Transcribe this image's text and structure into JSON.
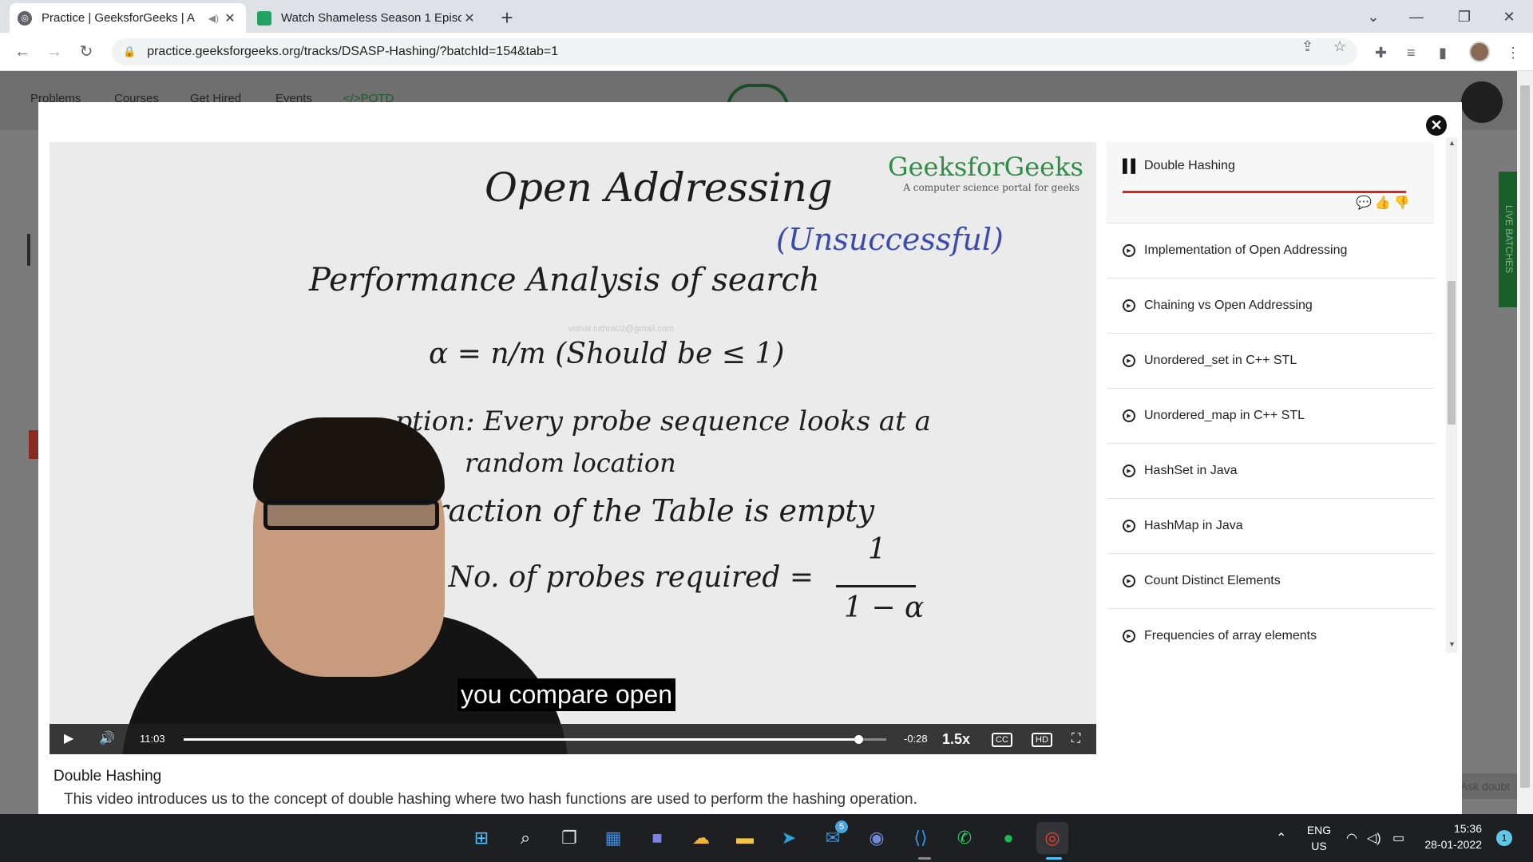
{
  "tabs": [
    {
      "title": "Practice | GeeksforGeeks | A",
      "active": true
    },
    {
      "title": "Watch Shameless Season 1 Episo",
      "active": false
    }
  ],
  "address_url": "practice.geeksforgeeks.org/tracks/DSASP-Hashing/?batchId=154&tab=1",
  "page_nav": [
    "Problems",
    "Courses",
    "Get Hired",
    "Events",
    "</>POTD"
  ],
  "live_tab": "LIVE BATCHES",
  "ask_doubt": "Ask doubt",
  "video": {
    "whiteboard": {
      "title": "Open Addressing",
      "heading": "Performance Analysis of search",
      "heading_note": "(Unsuccessful)",
      "alpha_line": "α = n/m (Should be ≤ 1)",
      "assumption_1": "...ption: Every probe sequence looks at a",
      "assumption_2": "random location",
      "fraction": "Fraction of the Table is empty",
      "probes": "...ted No. of probes required =",
      "formula_num": "1",
      "formula_den": "1 − α",
      "watermark": "vishal.luthra02@gmail.com"
    },
    "brand": {
      "name": "GeeksforGeeks",
      "tagline": "A computer science portal for geeks"
    },
    "subtitle": "you compare open",
    "current_time": "11:03",
    "remaining_time": "-0:28",
    "speed": "1.5x",
    "progress": 0.96
  },
  "video_title": "Double Hashing",
  "video_description": "This video introduces us to the concept of double hashing where two hash functions are used to perform the hashing operation.",
  "playlist": {
    "active": "Double Hashing",
    "items": [
      "Implementation of Open Addressing",
      "Chaining vs Open Addressing",
      "Unordered_set in C++ STL",
      "Unordered_map in C++ STL",
      "HashSet in Java",
      "HashMap in Java",
      "Count Distinct Elements",
      "Frequencies of array elements"
    ]
  },
  "taskbar": {
    "lang": "ENG",
    "region": "US",
    "time": "15:36",
    "date": "28-01-2022",
    "notification_count": "1",
    "mail_badge": "5"
  }
}
